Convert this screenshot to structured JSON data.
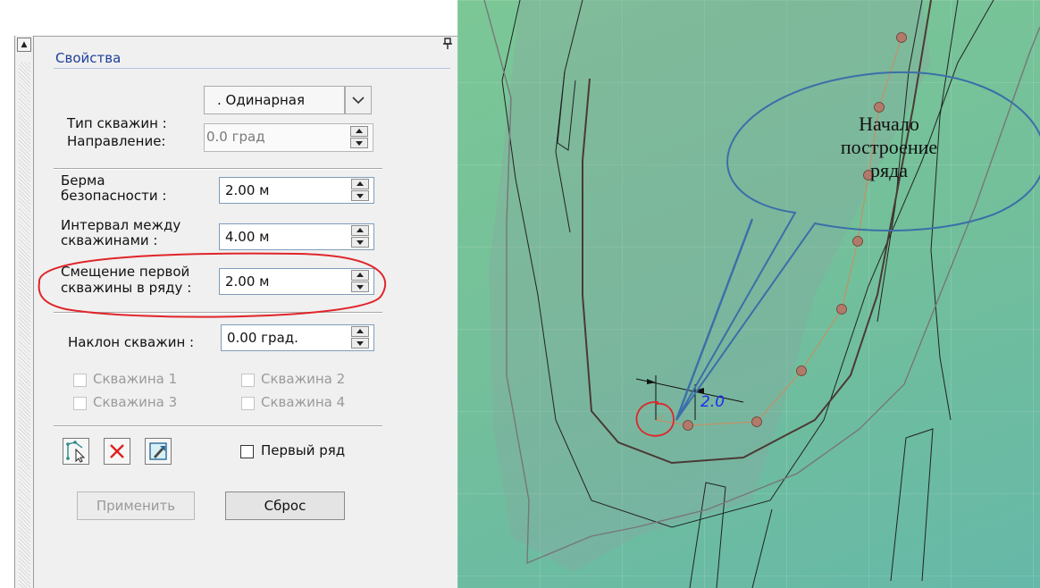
{
  "panel": {
    "title": "Свойства",
    "pin_glyph": "ᵖ",
    "well_type_label": "Тип скважин :",
    "well_type_value": ". Одинарная",
    "direction_label": "Направление:",
    "direction_value": "0.0 град",
    "safety_berm_label_1": "Берма",
    "safety_berm_label_2": "безопасности :",
    "safety_berm_value": "2.00 м",
    "interval_label_1": "Интервал между",
    "interval_label_2": "скважинами :",
    "interval_value": "4.00 м",
    "offset_label_1": "Смещение первой",
    "offset_label_2": "скважины в ряду :",
    "offset_value": "2.00 м",
    "tilt_label": "Наклон скважин :",
    "tilt_value": "0.00 град.",
    "well_checks": [
      "Скважина 1",
      "Скважина 2",
      "Скважина 3",
      "Скважина 4"
    ],
    "first_row_label": "Первый ряд",
    "apply_label": "Применить",
    "reset_label": "Сброс"
  },
  "viewport": {
    "callout_line1": "Начало",
    "callout_line2": "построение",
    "callout_line3": "ряда",
    "dimension_value": "2.0"
  },
  "icons": [
    "scroll-up-arrow-icon",
    "pin-icon",
    "dropdown-arrow-icon",
    "spinner-icon",
    "select-boundary-icon",
    "delete-icon",
    "edit-row-icon"
  ],
  "colors": {
    "title_blue": "#1f3e9a",
    "annotation_red": "#e0252a",
    "callout_blue": "#3b6fa8",
    "well_point": "#b17a6a",
    "dimension_blue": "#1c2cf0"
  }
}
